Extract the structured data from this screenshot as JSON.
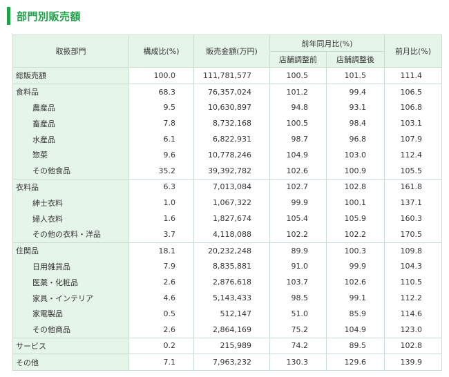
{
  "page": {
    "title": "部門別販売額",
    "accent": "#1fa14a",
    "header_bg": "#e6f5ea"
  },
  "table": {
    "headers": {
      "department": "取扱部門",
      "ratio": "構成比(%)",
      "sales": "販売金額(万円)",
      "yoy": "前年同月比(%)",
      "yoy_before": "店舗調整前",
      "yoy_after": "店舗調整後",
      "mom": "前月比(%)"
    },
    "rows": [
      {
        "name": "総販売額",
        "ratio": "100.0",
        "sales": "111,781,577",
        "before": "100.5",
        "after": "101.5",
        "mom": "111.4"
      },
      {
        "name": "食料品",
        "ratio": "68.3",
        "sales": "76,357,024",
        "before": "101.2",
        "after": "99.4",
        "mom": "106.5"
      },
      {
        "name": "農産品",
        "ratio": "9.5",
        "sales": "10,630,897",
        "before": "94.8",
        "after": "93.1",
        "mom": "106.8"
      },
      {
        "name": "畜産品",
        "ratio": "7.8",
        "sales": "8,732,168",
        "before": "100.5",
        "after": "98.4",
        "mom": "103.1"
      },
      {
        "name": "水産品",
        "ratio": "6.1",
        "sales": "6,822,931",
        "before": "98.7",
        "after": "96.8",
        "mom": "107.9"
      },
      {
        "name": "惣菜",
        "ratio": "9.6",
        "sales": "10,778,246",
        "before": "104.9",
        "after": "103.0",
        "mom": "112.4"
      },
      {
        "name": "その他食品",
        "ratio": "35.2",
        "sales": "39,392,782",
        "before": "102.6",
        "after": "100.9",
        "mom": "105.5"
      },
      {
        "name": "衣料品",
        "ratio": "6.3",
        "sales": "7,013,084",
        "before": "102.7",
        "after": "102.8",
        "mom": "161.8"
      },
      {
        "name": "紳士衣料",
        "ratio": "1.0",
        "sales": "1,067,322",
        "before": "99.9",
        "after": "100.1",
        "mom": "137.1"
      },
      {
        "name": "婦人衣料",
        "ratio": "1.6",
        "sales": "1,827,674",
        "before": "105.4",
        "after": "105.9",
        "mom": "160.3"
      },
      {
        "name": "その他の衣料・洋品",
        "ratio": "3.7",
        "sales": "4,118,088",
        "before": "102.2",
        "after": "102.2",
        "mom": "170.5"
      },
      {
        "name": "住関品",
        "ratio": "18.1",
        "sales": "20,232,248",
        "before": "89.9",
        "after": "100.3",
        "mom": "109.8"
      },
      {
        "name": "日用雑貨品",
        "ratio": "7.9",
        "sales": "8,835,881",
        "before": "91.0",
        "after": "99.9",
        "mom": "104.3"
      },
      {
        "name": "医薬・化粧品",
        "ratio": "2.6",
        "sales": "2,876,618",
        "before": "103.7",
        "after": "102.6",
        "mom": "110.5"
      },
      {
        "name": "家具・インテリア",
        "ratio": "4.6",
        "sales": "5,143,433",
        "before": "98.5",
        "after": "99.1",
        "mom": "112.2"
      },
      {
        "name": "家電製品",
        "ratio": "0.5",
        "sales": "512,147",
        "before": "51.0",
        "after": "85.9",
        "mom": "114.6"
      },
      {
        "name": "その他商品",
        "ratio": "2.6",
        "sales": "2,864,169",
        "before": "75.2",
        "after": "104.9",
        "mom": "123.0"
      },
      {
        "name": "サービス",
        "ratio": "0.2",
        "sales": "215,989",
        "before": "74.2",
        "after": "89.5",
        "mom": "102.8"
      },
      {
        "name": "その他",
        "ratio": "7.1",
        "sales": "7,963,232",
        "before": "130.3",
        "after": "129.6",
        "mom": "139.9"
      }
    ]
  }
}
